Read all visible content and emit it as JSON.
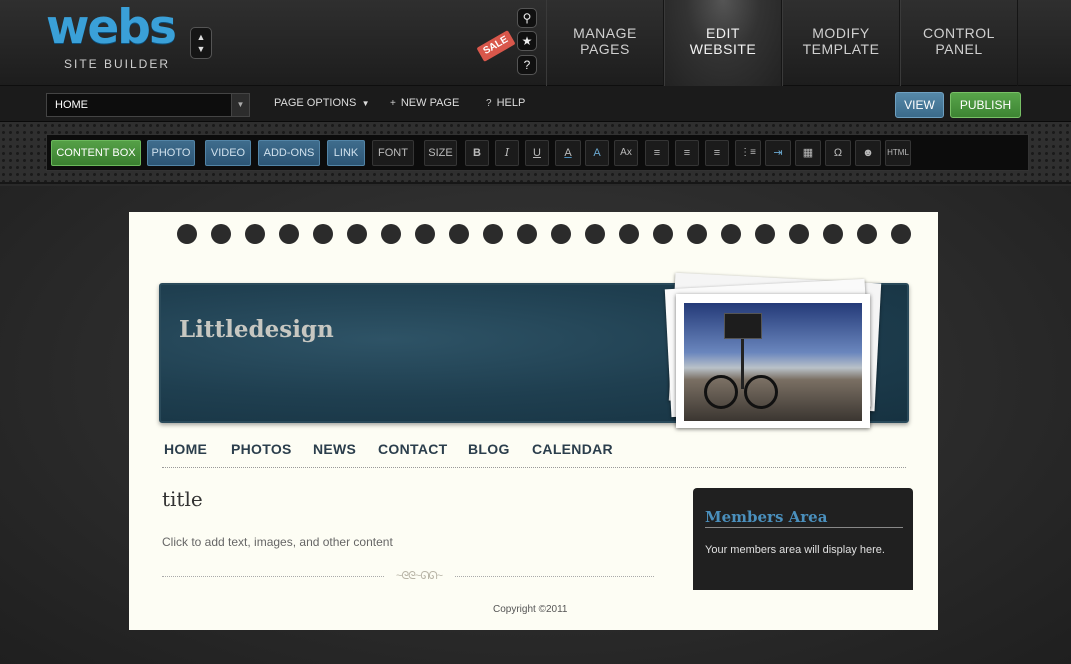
{
  "logo": {
    "word": "webs",
    "subtitle": "SITE BUILDER"
  },
  "top_icons": {
    "sale_badge": "SALE",
    "search": "search-icon",
    "favorite": "star-icon",
    "help": "question-icon"
  },
  "nav_tabs": [
    {
      "line1": "MANAGE",
      "line2": "PAGES"
    },
    {
      "line1": "EDIT",
      "line2": "WEBSITE"
    },
    {
      "line1": "MODIFY",
      "line2": "TEMPLATE"
    },
    {
      "line1": "CONTROL",
      "line2": "PANEL"
    }
  ],
  "subbar": {
    "page_select_value": "HOME",
    "page_options": "PAGE OPTIONS",
    "new_page": "NEW PAGE",
    "help": "HELP",
    "view": "VIEW",
    "publish": "PUBLISH"
  },
  "toolbar": {
    "content_box": "CONTENT BOX",
    "photo": "PHOTO",
    "video": "VIDEO",
    "addons": "ADD-ONS",
    "link": "LINK",
    "font": "FONT",
    "size": "SIZE",
    "bold": "B",
    "italic": "I",
    "underline": "U",
    "text_color": "A",
    "highlight": "A",
    "clear_format": "Ax",
    "align_left": "≡",
    "align_center": "≡",
    "align_right": "≡",
    "list": "⋮≡",
    "indent": "⇥",
    "table": "▦",
    "special_char": "Ω",
    "emoticon": "☻",
    "html": "HTML"
  },
  "site": {
    "title": "Littledesign",
    "nav": [
      "HOME",
      "PHOTOS",
      "NEWS",
      "CONTACT",
      "BLOG",
      "CALENDAR"
    ],
    "content_title": "title",
    "content_hint": "Click to add text, images, and other content",
    "members_title": "Members Area",
    "members_text": "Your members area will display here.",
    "copyright": "Copyright ©2011"
  },
  "colors": {
    "brand_blue": "#3aa0d8",
    "publish_green": "#4a9a3e",
    "view_blue": "#4a7a9a",
    "banner": "#1f3f50",
    "paper": "#fdfdf4"
  }
}
